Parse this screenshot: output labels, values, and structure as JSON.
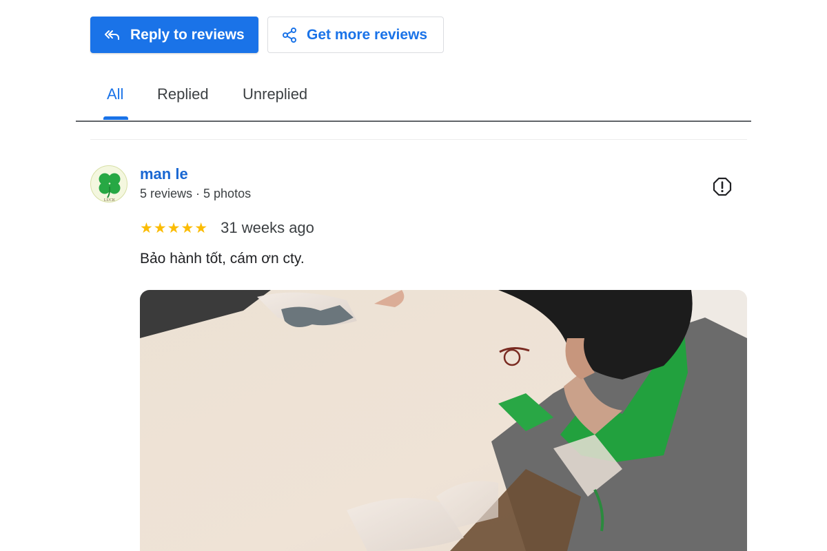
{
  "toolbar": {
    "reply_label": "Reply to reviews",
    "get_more_label": "Get more reviews"
  },
  "tabs": [
    {
      "label": "All",
      "active": true
    },
    {
      "label": "Replied",
      "active": false
    },
    {
      "label": "Unreplied",
      "active": false
    }
  ],
  "review": {
    "author": "man le",
    "author_meta": "5 reviews · 5 photos",
    "avatar_icon": "four-leaf-clover-icon",
    "avatar_text": "LUCK",
    "stars": "★★★★★",
    "rating": 5,
    "time": "31 weeks ago",
    "text": "Bảo hành tốt, cám ơn cty.",
    "flag_icon": "report-flag-icon"
  },
  "colors": {
    "accent": "#1a73e8",
    "star": "#fbbc04",
    "link": "#1967d2"
  }
}
